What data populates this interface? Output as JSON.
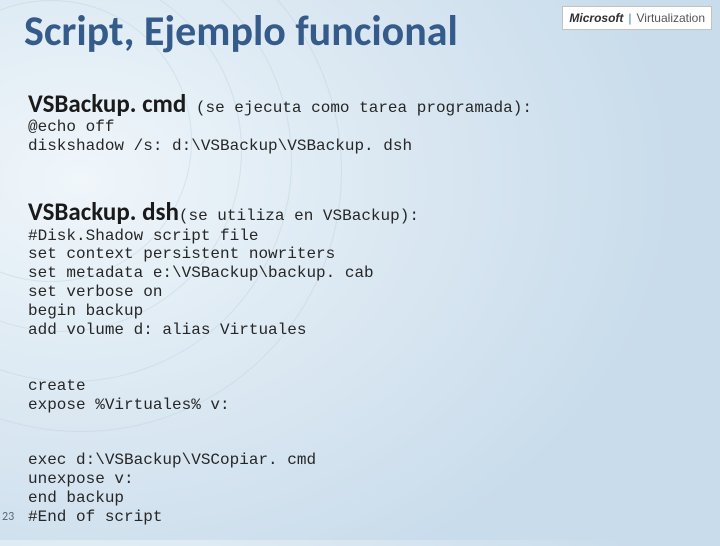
{
  "title": "Script, Ejemplo funcional",
  "logo": {
    "ms": "Microsoft",
    "sep": "|",
    "virt": "Virtualization"
  },
  "page_number": "23",
  "section1": {
    "heading": "VSBackup. cmd",
    "note": " (se ejecuta como tarea programada):",
    "body": "@echo off\ndiskshadow /s: d:\\VSBackup\\VSBackup. dsh"
  },
  "section2": {
    "heading": "VSBackup. dsh",
    "note": "(se utiliza en VSBackup):",
    "body": "#Disk.Shadow script file\nset context persistent nowriters\nset metadata e:\\VSBackup\\backup. cab\nset verbose on\nbegin backup\nadd volume d: alias Virtuales"
  },
  "section3": {
    "body": "create\nexpose %Virtuales% v:"
  },
  "section4": {
    "body": "exec d:\\VSBackup\\VSCopiar. cmd\nunexpose v:\nend backup\n#End of script"
  }
}
